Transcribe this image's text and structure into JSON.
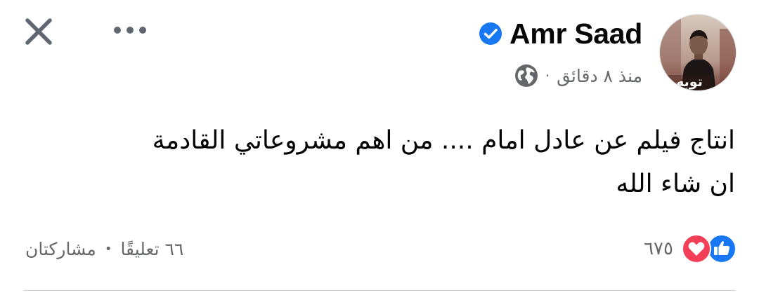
{
  "post": {
    "author": "Amr Saad",
    "verified": true,
    "time": "منذ ٨ دقائق",
    "separator": "·",
    "audience_icon": "globe-icon",
    "text_line1": "انتاج فيلم عن عادل امام .... من اهم مشروعاتي القادمة",
    "text_line2": "ان شاء الله",
    "avatar_caption": "توبه"
  },
  "engagement": {
    "reaction_icons": [
      "like-icon",
      "love-icon"
    ],
    "reaction_count": "٦٧٥",
    "comments": "٦٦ تعليقًا",
    "dot": "•",
    "shares": "مشاركتان"
  },
  "colors": {
    "verified_blue": "#1877f2",
    "like_blue": "#1877f2",
    "love_red": "#f33e58",
    "secondary_text": "#65676b",
    "icon_gray": "#606770",
    "divider": "#ced0d4"
  }
}
